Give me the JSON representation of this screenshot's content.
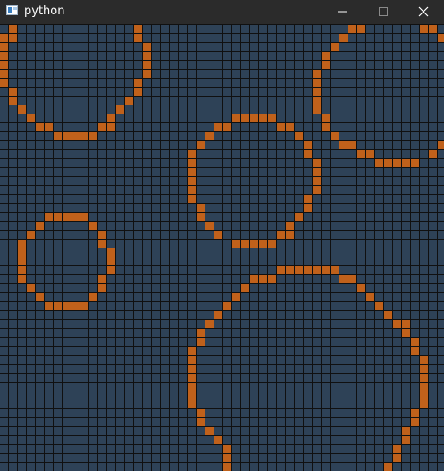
{
  "window": {
    "title": "python",
    "controls": {
      "minimize": "minimize-icon",
      "maximize": "maximize-icon",
      "close": "close-icon"
    }
  },
  "grid": {
    "columns": 50,
    "rows": 50,
    "colors": {
      "background": "#101010",
      "empty_cell": "#2e4257",
      "filled_cell": "#c0611b"
    },
    "filled_cells": [
      [
        1,
        0
      ],
      [
        15,
        0
      ],
      [
        39,
        0
      ],
      [
        40,
        0
      ],
      [
        47,
        0
      ],
      [
        48,
        0
      ],
      [
        0,
        1
      ],
      [
        1,
        1
      ],
      [
        15,
        1
      ],
      [
        38,
        1
      ],
      [
        49,
        1
      ],
      [
        0,
        2
      ],
      [
        16,
        2
      ],
      [
        37,
        2
      ],
      [
        0,
        3
      ],
      [
        16,
        3
      ],
      [
        36,
        3
      ],
      [
        0,
        4
      ],
      [
        16,
        4
      ],
      [
        36,
        4
      ],
      [
        0,
        5
      ],
      [
        16,
        5
      ],
      [
        35,
        5
      ],
      [
        0,
        6
      ],
      [
        15,
        6
      ],
      [
        35,
        6
      ],
      [
        1,
        7
      ],
      [
        15,
        7
      ],
      [
        35,
        7
      ],
      [
        1,
        8
      ],
      [
        14,
        8
      ],
      [
        35,
        8
      ],
      [
        2,
        9
      ],
      [
        13,
        9
      ],
      [
        35,
        9
      ],
      [
        3,
        10
      ],
      [
        12,
        10
      ],
      [
        26,
        10
      ],
      [
        27,
        10
      ],
      [
        28,
        10
      ],
      [
        29,
        10
      ],
      [
        30,
        10
      ],
      [
        36,
        10
      ],
      [
        4,
        11
      ],
      [
        5,
        11
      ],
      [
        11,
        11
      ],
      [
        12,
        11
      ],
      [
        24,
        11
      ],
      [
        25,
        11
      ],
      [
        31,
        11
      ],
      [
        32,
        11
      ],
      [
        36,
        11
      ],
      [
        6,
        12
      ],
      [
        7,
        12
      ],
      [
        8,
        12
      ],
      [
        9,
        12
      ],
      [
        10,
        12
      ],
      [
        23,
        12
      ],
      [
        33,
        12
      ],
      [
        37,
        12
      ],
      [
        22,
        13
      ],
      [
        34,
        13
      ],
      [
        38,
        13
      ],
      [
        39,
        13
      ],
      [
        49,
        13
      ],
      [
        21,
        14
      ],
      [
        34,
        14
      ],
      [
        40,
        14
      ],
      [
        41,
        14
      ],
      [
        48,
        14
      ],
      [
        21,
        15
      ],
      [
        35,
        15
      ],
      [
        42,
        15
      ],
      [
        43,
        15
      ],
      [
        44,
        15
      ],
      [
        45,
        15
      ],
      [
        46,
        15
      ],
      [
        21,
        16
      ],
      [
        35,
        16
      ],
      [
        21,
        17
      ],
      [
        35,
        17
      ],
      [
        21,
        18
      ],
      [
        35,
        18
      ],
      [
        21,
        19
      ],
      [
        34,
        19
      ],
      [
        22,
        20
      ],
      [
        34,
        20
      ],
      [
        5,
        21
      ],
      [
        6,
        21
      ],
      [
        7,
        21
      ],
      [
        8,
        21
      ],
      [
        9,
        21
      ],
      [
        22,
        21
      ],
      [
        33,
        21
      ],
      [
        4,
        22
      ],
      [
        10,
        22
      ],
      [
        23,
        22
      ],
      [
        32,
        22
      ],
      [
        3,
        23
      ],
      [
        11,
        23
      ],
      [
        24,
        23
      ],
      [
        31,
        23
      ],
      [
        32,
        23
      ],
      [
        2,
        24
      ],
      [
        11,
        24
      ],
      [
        26,
        24
      ],
      [
        27,
        24
      ],
      [
        28,
        24
      ],
      [
        29,
        24
      ],
      [
        30,
        24
      ],
      [
        2,
        25
      ],
      [
        12,
        25
      ],
      [
        2,
        26
      ],
      [
        12,
        26
      ],
      [
        2,
        27
      ],
      [
        12,
        27
      ],
      [
        31,
        27
      ],
      [
        32,
        27
      ],
      [
        33,
        27
      ],
      [
        34,
        27
      ],
      [
        35,
        27
      ],
      [
        36,
        27
      ],
      [
        37,
        27
      ],
      [
        2,
        28
      ],
      [
        11,
        28
      ],
      [
        28,
        28
      ],
      [
        29,
        28
      ],
      [
        30,
        28
      ],
      [
        38,
        28
      ],
      [
        39,
        28
      ],
      [
        3,
        29
      ],
      [
        11,
        29
      ],
      [
        27,
        29
      ],
      [
        40,
        29
      ],
      [
        4,
        30
      ],
      [
        10,
        30
      ],
      [
        26,
        30
      ],
      [
        41,
        30
      ],
      [
        5,
        31
      ],
      [
        6,
        31
      ],
      [
        7,
        31
      ],
      [
        8,
        31
      ],
      [
        9,
        31
      ],
      [
        25,
        31
      ],
      [
        42,
        31
      ],
      [
        24,
        32
      ],
      [
        43,
        32
      ],
      [
        23,
        33
      ],
      [
        44,
        33
      ],
      [
        45,
        33
      ],
      [
        22,
        34
      ],
      [
        45,
        34
      ],
      [
        22,
        35
      ],
      [
        46,
        35
      ],
      [
        21,
        36
      ],
      [
        46,
        36
      ],
      [
        21,
        37
      ],
      [
        47,
        37
      ],
      [
        21,
        38
      ],
      [
        47,
        38
      ],
      [
        21,
        39
      ],
      [
        47,
        39
      ],
      [
        21,
        40
      ],
      [
        47,
        40
      ],
      [
        21,
        41
      ],
      [
        47,
        41
      ],
      [
        21,
        42
      ],
      [
        47,
        42
      ],
      [
        22,
        43
      ],
      [
        46,
        43
      ],
      [
        22,
        44
      ],
      [
        46,
        44
      ],
      [
        23,
        45
      ],
      [
        45,
        45
      ],
      [
        24,
        46
      ],
      [
        45,
        46
      ],
      [
        25,
        47
      ],
      [
        44,
        47
      ],
      [
        25,
        48
      ],
      [
        44,
        48
      ],
      [
        25,
        49
      ],
      [
        43,
        49
      ]
    ]
  }
}
